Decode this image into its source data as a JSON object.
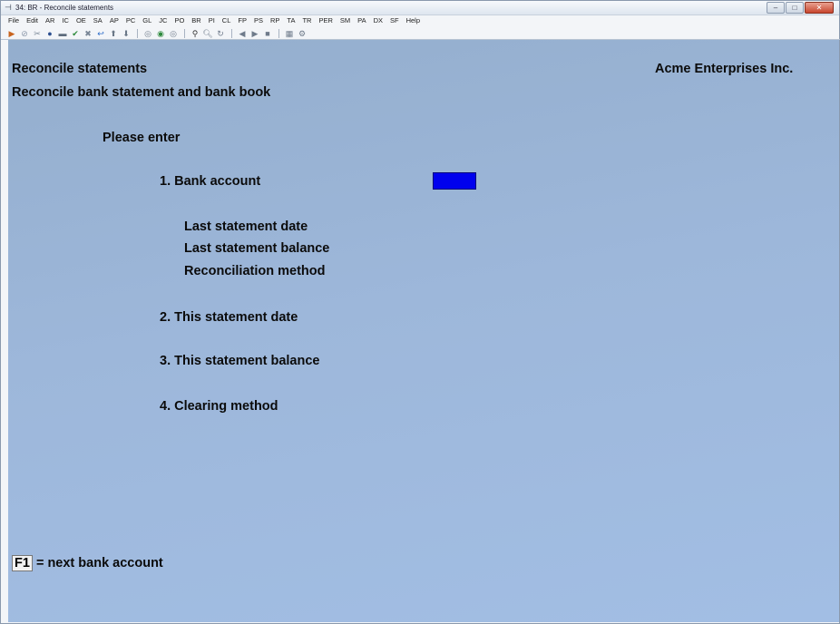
{
  "window": {
    "title": "34: BR - Reconcile statements"
  },
  "menu": [
    "File",
    "Edit",
    "AR",
    "IC",
    "OE",
    "SA",
    "AP",
    "PC",
    "GL",
    "JC",
    "PO",
    "BR",
    "PI",
    "CL",
    "FP",
    "PS",
    "RP",
    "TA",
    "TR",
    "PER",
    "SM",
    "PA",
    "DX",
    "SF",
    "Help"
  ],
  "toolbar": {
    "icons": [
      "go-icon",
      "stop-icon",
      "tools-icon",
      "globe-icon",
      "print-icon",
      "check-icon",
      "cancel-icon",
      "undo-icon",
      "up-arrow-icon",
      "down-arrow-icon",
      "first-icon",
      "next-record-icon",
      "last-icon",
      "find-icon",
      "zoom-icon",
      "refresh-icon",
      "prev-icon",
      "play-icon",
      "record-icon",
      "calculator-icon",
      "settings-icon"
    ]
  },
  "screen": {
    "title": "Reconcile statements",
    "company": "Acme Enterprises Inc.",
    "subtitle": "Reconcile bank statement and bank book",
    "prompt": "Please enter",
    "field1": "1. Bank account",
    "info1": "Last statement date",
    "info2": "Last statement balance",
    "info3": "Reconciliation method",
    "field2": "2. This statement date",
    "field3": "3. This statement balance",
    "field4": "4. Clearing method",
    "bank_account_value": "",
    "footer_key": "F1",
    "footer_text": " = next bank account"
  },
  "colors": {
    "screen_bg": "#9db7da",
    "input_highlight": "#0000ee"
  }
}
